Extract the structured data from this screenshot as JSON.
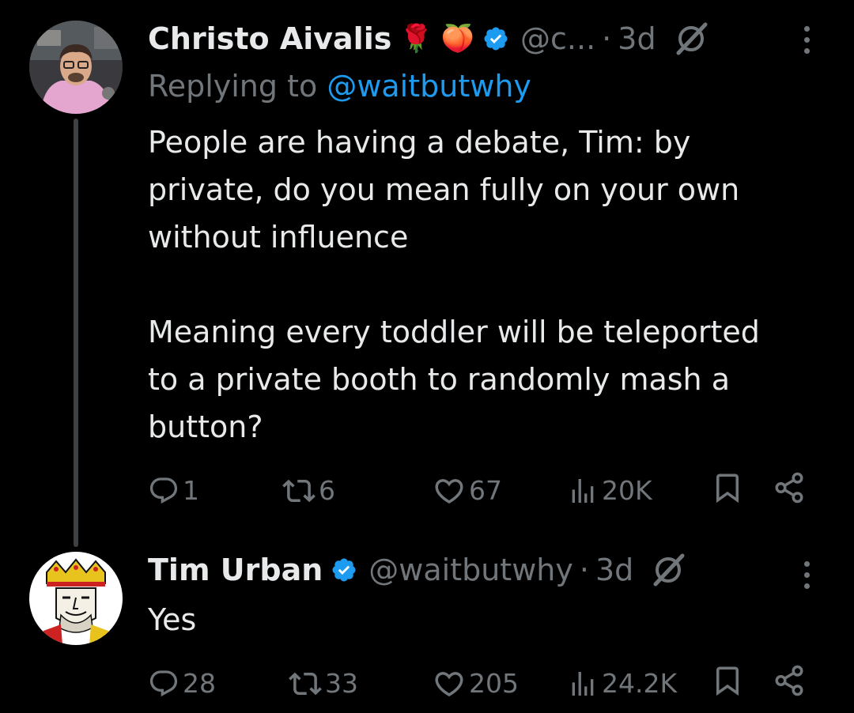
{
  "tweets": [
    {
      "author_name": "Christo Aivalis",
      "emojis": [
        "🌹",
        "🍑"
      ],
      "handle": "@c...",
      "separator": "·",
      "time": "3d",
      "replying_prefix": "Replying to ",
      "replying_to": "@waitbutwhy",
      "text": "People are having a debate, Tim: by\nprivate, do you mean fully on your own\nwithout influence\n\nMeaning every toddler will be teleported\nto a private booth to randomly mash a\nbutton?",
      "stats": {
        "replies": "1",
        "reposts": "6",
        "likes": "67",
        "views": "20K"
      }
    },
    {
      "author_name": "Tim Urban",
      "handle": "@waitbutwhy",
      "separator": "·",
      "time": "3d",
      "text": "Yes",
      "stats": {
        "replies": "28",
        "reposts": "33",
        "likes": "205",
        "views": "24.2K"
      }
    }
  ],
  "colors": {
    "background": "#000000",
    "primary_text": "#e7e9ea",
    "secondary_text": "#71767b",
    "accent": "#1d9bf0",
    "thread_line": "#3e4144"
  },
  "icons": [
    "verified-badge-icon",
    "grok-icon",
    "more-options-icon",
    "reply-icon",
    "repost-icon",
    "like-icon",
    "views-icon",
    "bookmark-icon",
    "share-icon"
  ]
}
